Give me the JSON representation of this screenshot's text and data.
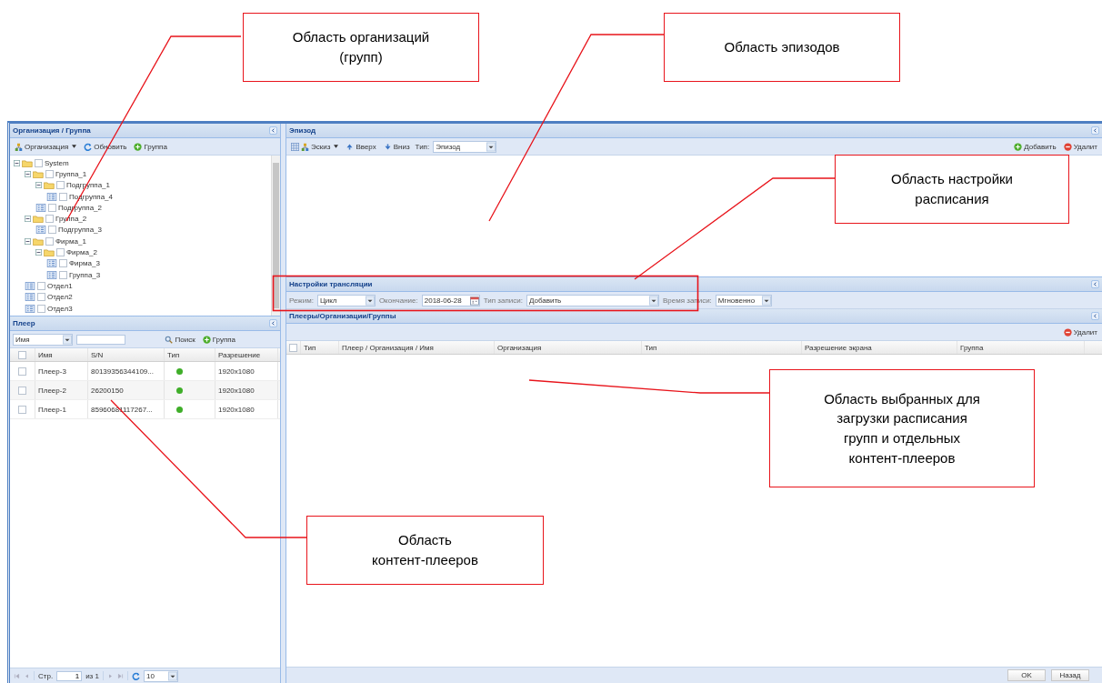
{
  "callouts": [
    {
      "lines": [
        "Область организаций",
        "(групп)"
      ]
    },
    {
      "lines": [
        "Область эпизодов"
      ]
    },
    {
      "lines": [
        "Область настройки",
        "расписания"
      ]
    },
    {
      "lines": [
        "Область выбранных для",
        "загрузки расписания",
        "групп и отдельных",
        "контент-плееров"
      ]
    },
    {
      "lines": [
        "Область",
        "контент-плееров"
      ]
    }
  ],
  "org_panel": {
    "title": "Организация / Группа",
    "toolbar": [
      {
        "kind": "menu",
        "label": "Организация"
      },
      {
        "kind": "refresh",
        "label": "Обновить"
      },
      {
        "kind": "add",
        "label": "Группа"
      }
    ],
    "tree": [
      {
        "label": "System",
        "checked": false,
        "expanded": true,
        "children": [
          {
            "label": "Группа_1",
            "checked": false,
            "expanded": true,
            "children": [
              {
                "label": "Подгруппа_1",
                "checked": false,
                "expanded": true,
                "children": [
                  {
                    "label": "Подгруппа_4",
                    "checked": false
                  }
                ]
              },
              {
                "label": "Подгруппа_2",
                "checked": false
              }
            ]
          },
          {
            "label": "Группа_2",
            "checked": false,
            "expanded": true,
            "children": [
              {
                "label": "Подгруппа_3",
                "checked": false
              }
            ]
          },
          {
            "label": "Фирма_1",
            "checked": false,
            "expanded": true,
            "children": [
              {
                "label": "Фирма_2",
                "checked": false,
                "expanded": true,
                "children": [
                  {
                    "label": "Фирма_3",
                    "checked": false
                  },
                  {
                    "label": "Группа_3",
                    "checked": false
                  }
                ]
              }
            ]
          },
          {
            "label": "Отдел1",
            "checked": false
          },
          {
            "label": "Отдел2",
            "checked": false
          },
          {
            "label": "Отдел3",
            "checked": false
          }
        ]
      }
    ]
  },
  "player_panel": {
    "title": "Плеер",
    "filter_field": "Имя",
    "toolbar": [
      {
        "kind": "search",
        "label": "Поиск"
      },
      {
        "kind": "add",
        "label": "Группа"
      }
    ],
    "select_all_checked": false,
    "columns": [
      "Имя",
      "S/N",
      "Тип",
      "Разрешение"
    ],
    "rows": [
      {
        "name": "Плеер-3",
        "sn": "80139356344109...",
        "color": "#3fae29",
        "resolution": "1920x1080",
        "checked": false
      },
      {
        "name": "Плеер-2",
        "sn": "26200150",
        "color": "#3fae29",
        "resolution": "1920x1080",
        "checked": false
      },
      {
        "name": "Плеер-1",
        "sn": "85960681117267...",
        "color": "#3fae29",
        "resolution": "1920x1080",
        "checked": false
      }
    ],
    "pager": {
      "page_label": "Стр.",
      "page": "1",
      "of": "из 1",
      "page_size": "10"
    }
  },
  "episode_panel": {
    "title": "Эпизод",
    "toolbar": [
      {
        "kind": "menu",
        "label": "Эскиз"
      },
      {
        "kind": "up",
        "label": "Вверх"
      },
      {
        "kind": "down",
        "label": "Вниз"
      }
    ],
    "type_label": "Тип:",
    "type_value": "Эпизод",
    "actions": [
      {
        "kind": "add",
        "label": "Добавить"
      },
      {
        "kind": "delete",
        "label": "Удалит"
      }
    ]
  },
  "settings_panel": {
    "title": "Настройки трансляции",
    "fields": [
      {
        "label": "Режим:",
        "value": "Цикл",
        "kind": "select"
      },
      {
        "label": "Окончание:",
        "value": "2018-06-28",
        "kind": "date"
      },
      {
        "label": "Тип записи:",
        "value": "Добавить",
        "kind": "select"
      },
      {
        "label": "Время записи:",
        "value": "Мгновенно",
        "kind": "select"
      }
    ]
  },
  "targets_panel": {
    "title": "Плееры/Организации/Группы",
    "actions": [
      {
        "kind": "delete",
        "label": "Удалит"
      }
    ],
    "select_all_checked": false,
    "columns": [
      "Тип",
      "Плеер / Организация / Имя",
      "Организация",
      "Тип",
      "Разрешение экрана",
      "Группа"
    ]
  },
  "footer_buttons": [
    "OK",
    "Назад"
  ]
}
